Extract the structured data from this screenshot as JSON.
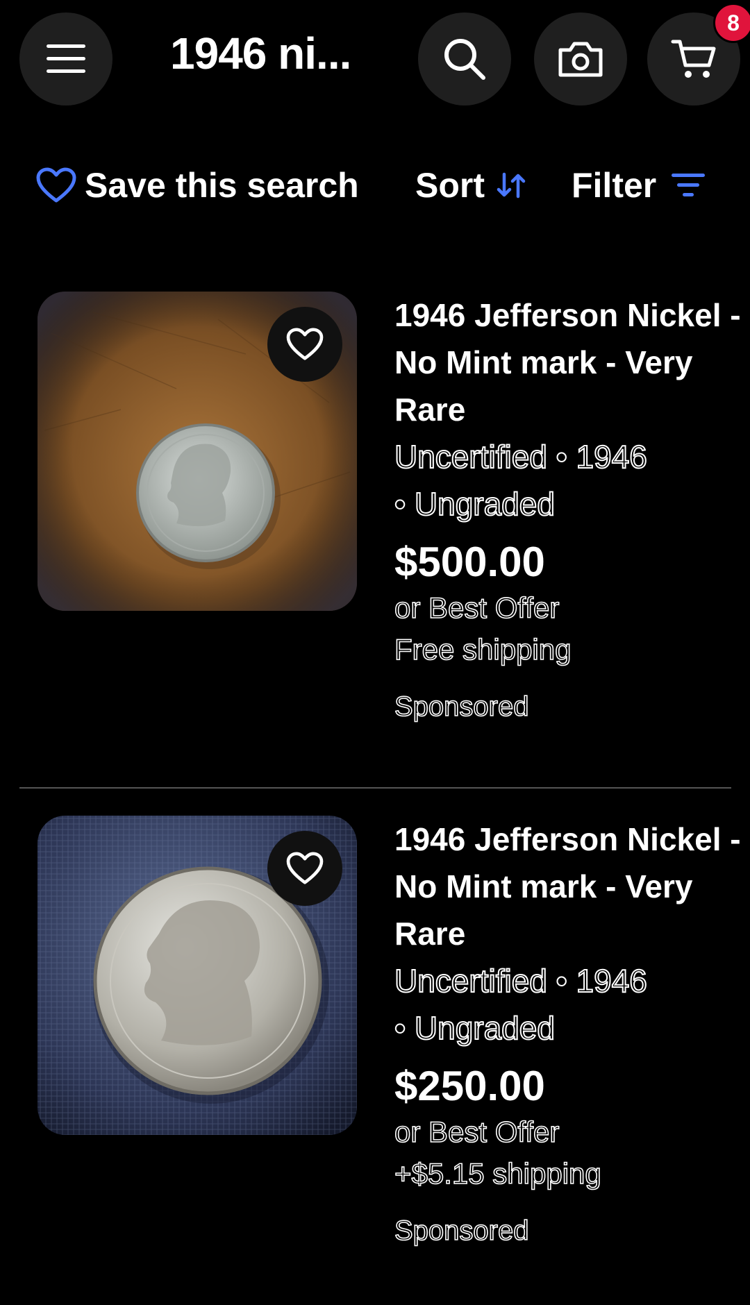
{
  "header": {
    "query_title": "1946 ni...",
    "cart_count": "8",
    "icons": [
      "menu-icon",
      "search-icon",
      "camera-icon",
      "cart-icon"
    ]
  },
  "actions": {
    "save_search_label": "Save this search",
    "sort_label": "Sort",
    "filter_label": "Filter"
  },
  "colors": {
    "accent_blue": "#4a78ff",
    "badge_red": "#e0143c",
    "button_bg": "#1f1f1f"
  },
  "listings": [
    {
      "title": "1946 Jefferson Nickel - No Mint mark - Very Rare",
      "aspect_line1": "Uncertified • 1946",
      "aspect_line2": "• Ungraded",
      "price": "$500.00",
      "offer": "or Best Offer",
      "shipping": "Free shipping",
      "sponsored": "Sponsored"
    },
    {
      "title": "1946 Jefferson Nickel - No Mint mark - Very Rare",
      "aspect_line1": "Uncertified • 1946",
      "aspect_line2": "• Ungraded",
      "price": "$250.00",
      "offer": "or Best Offer",
      "shipping": "+$5.15 shipping",
      "sponsored": "Sponsored"
    }
  ]
}
